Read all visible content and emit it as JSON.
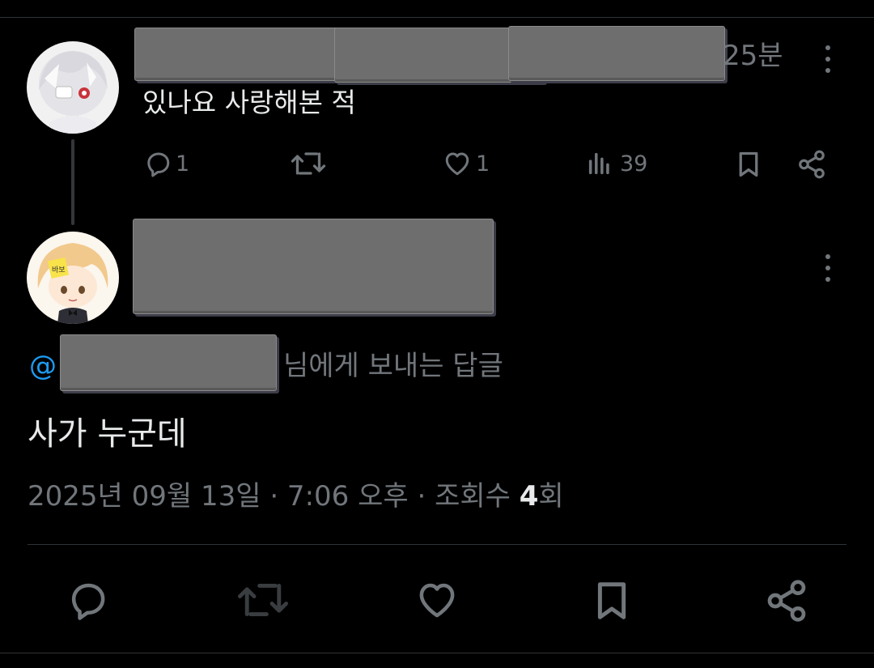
{
  "parent_tweet": {
    "timestamp": "25분",
    "text": "있나요 사랑해본 적",
    "actions": {
      "reply_count": "1",
      "like_count": "1",
      "view_count": "39"
    }
  },
  "main_tweet": {
    "reply_to_prefix": "@",
    "reply_to_suffix": "님에게 보내는 답글",
    "text": "사가 누군데",
    "meta_datetime": "2025년 09월 13일 · 7:06 오후 · 조회수 ",
    "meta_views": "4",
    "meta_views_unit": "회"
  },
  "icons": [
    "reply-icon",
    "retweet-icon",
    "like-icon",
    "views-icon",
    "bookmark-icon",
    "share-icon",
    "more-icon"
  ],
  "colors": {
    "background": "#000000",
    "text": "#e7e9ea",
    "muted": "#71767b",
    "accent": "#1d9bf0"
  }
}
